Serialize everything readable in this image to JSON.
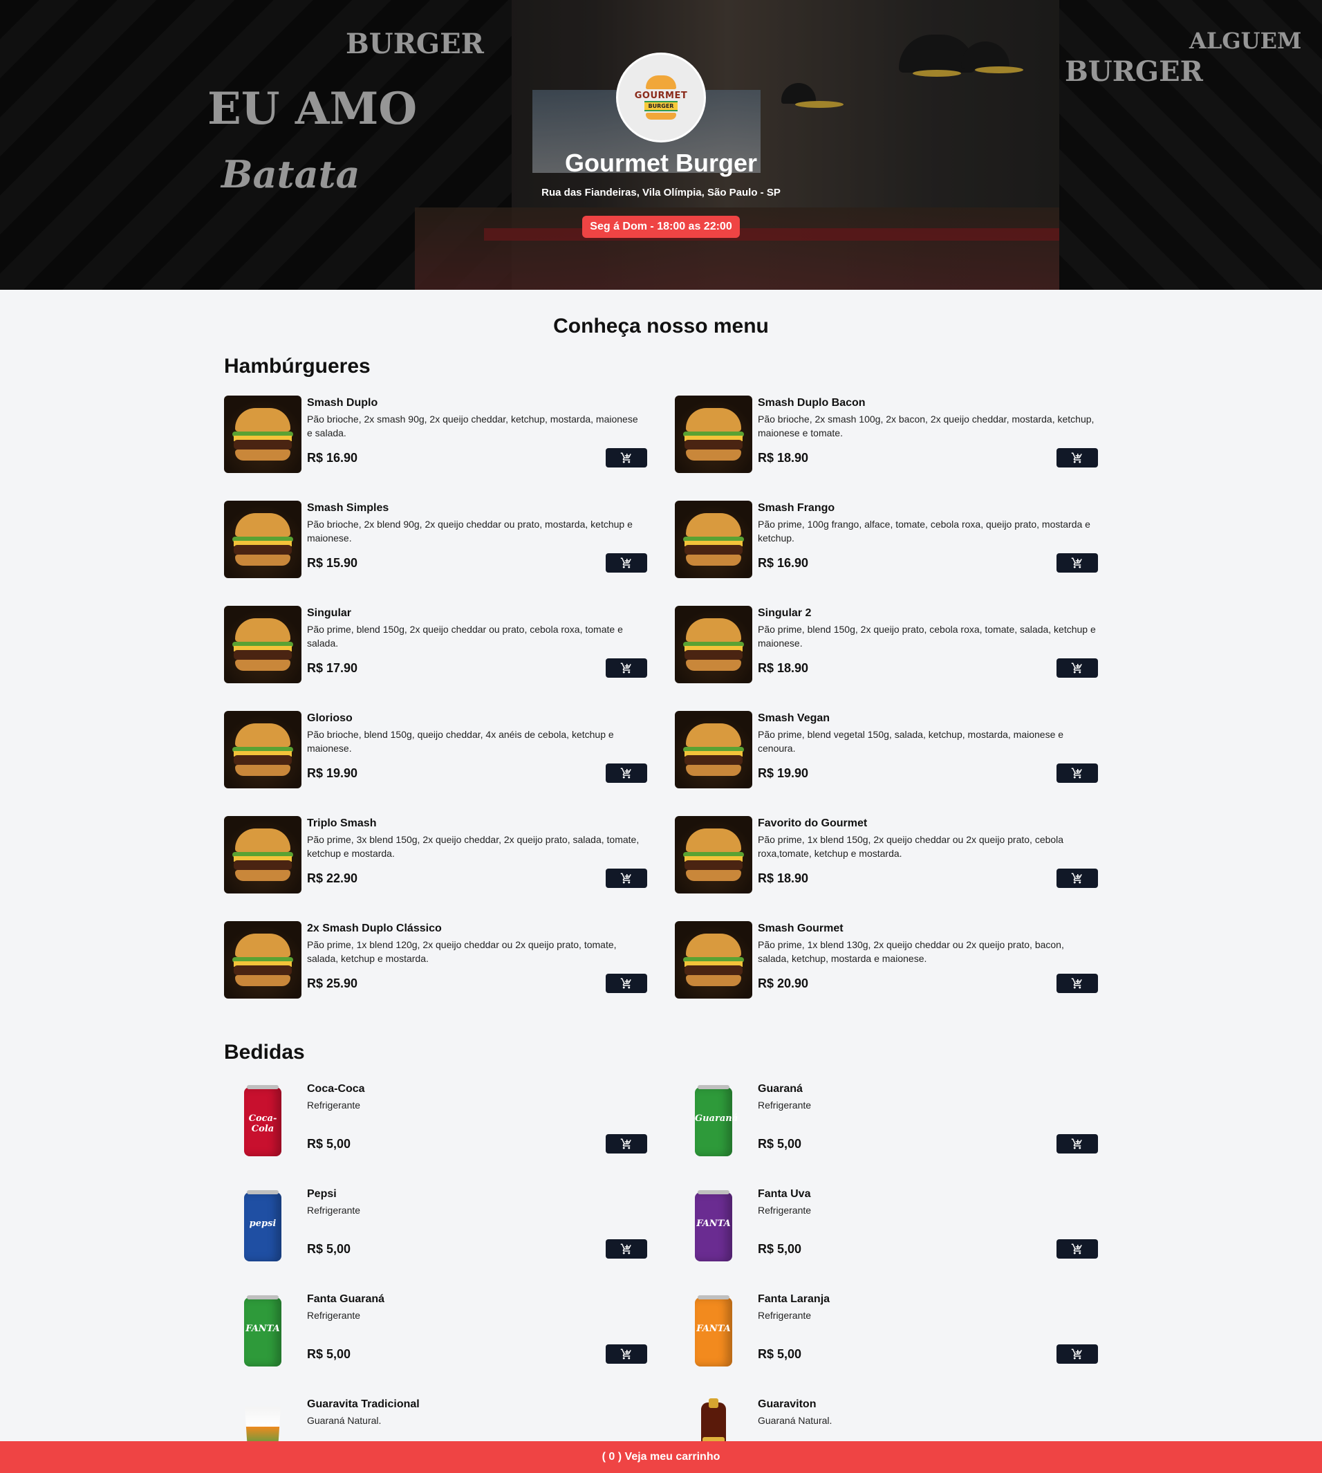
{
  "header": {
    "name": "Gourmet Burger",
    "address": "Rua das Fiandeiras, Vila Olímpia, São Paulo - SP",
    "hours": "Seg á Dom - 18:00 as 22:00",
    "logo_text": "GOURMET",
    "logo_sub": "BURGER",
    "logo_icon": "burger-logo"
  },
  "menu": {
    "title": "Conheça nosso menu",
    "sections": [
      {
        "title": "Hambúrgueres",
        "items": [
          {
            "name": "Smash Duplo",
            "desc": "Pão brioche, 2x smash 90g, 2x queijo cheddar, ketchup, mostarda, maionese e salada.",
            "price": "R$ 16.90"
          },
          {
            "name": "Smash Duplo Bacon",
            "desc": "Pão brioche, 2x smash 100g, 2x bacon, 2x queijo cheddar, mostarda, ketchup, maionese e tomate.",
            "price": "R$ 18.90"
          },
          {
            "name": "Smash Simples",
            "desc": "Pão brioche, 2x blend 90g, 2x queijo cheddar ou prato, mostarda, ketchup e maionese.",
            "price": "R$ 15.90"
          },
          {
            "name": "Smash Frango",
            "desc": "Pão prime, 100g frango, alface, tomate, cebola roxa, queijo prato, mostarda e ketchup.",
            "price": "R$ 16.90"
          },
          {
            "name": "Singular",
            "desc": "Pão prime, blend 150g, 2x queijo cheddar ou prato, cebola roxa, tomate e salada.",
            "price": "R$ 17.90"
          },
          {
            "name": "Singular 2",
            "desc": "Pão prime, blend 150g, 2x queijo prato, cebola roxa, tomate, salada, ketchup e maionese.",
            "price": "R$ 18.90"
          },
          {
            "name": "Glorioso",
            "desc": "Pão brioche, blend 150g, queijo cheddar, 4x anéis de cebola, ketchup e maionese.",
            "price": "R$ 19.90"
          },
          {
            "name": "Smash Vegan",
            "desc": "Pão prime, blend vegetal 150g, salada, ketchup, mostarda, maionese e cenoura.",
            "price": "R$ 19.90"
          },
          {
            "name": "Triplo Smash",
            "desc": "Pão prime, 3x blend 150g, 2x queijo cheddar, 2x queijo prato, salada, tomate, ketchup e mostarda.",
            "price": "R$ 22.90"
          },
          {
            "name": "Favorito do Gourmet",
            "desc": "Pão prime, 1x blend 150g, 2x queijo cheddar ou 2x queijo prato, cebola roxa,tomate, ketchup e mostarda.",
            "price": "R$ 18.90"
          },
          {
            "name": "2x Smash Duplo Clássico",
            "desc": "Pão prime, 1x blend 120g, 2x queijo cheddar ou 2x queijo prato, tomate, salada, ketchup e mostarda.",
            "price": "R$ 25.90"
          },
          {
            "name": "Smash Gourmet",
            "desc": "Pão prime, 1x blend 130g, 2x queijo cheddar ou 2x queijo prato, bacon, salada, ketchup, mostarda e maionese.",
            "price": "R$ 20.90"
          }
        ]
      },
      {
        "title": "Bedidas",
        "items": [
          {
            "name": "Coca-Coca",
            "desc": "Refrigerante",
            "price": "R$ 5,00",
            "can_color": "#c8102e",
            "can_text": "Coca-Cola"
          },
          {
            "name": "Guaraná",
            "desc": "Refrigerante",
            "price": "R$ 5,00",
            "can_color": "#2e9a3a",
            "can_text": "Guaraná"
          },
          {
            "name": "Pepsi",
            "desc": "Refrigerante",
            "price": "R$ 5,00",
            "can_color": "#1f4fa3",
            "can_text": "pepsi"
          },
          {
            "name": "Fanta Uva",
            "desc": "Refrigerante",
            "price": "R$ 5,00",
            "can_color": "#6a2c91",
            "can_text": "FANTA"
          },
          {
            "name": "Fanta Guaraná",
            "desc": "Refrigerante",
            "price": "R$ 5,00",
            "can_color": "#2e9a3a",
            "can_text": "FANTA"
          },
          {
            "name": "Fanta Laranja",
            "desc": "Refrigerante",
            "price": "R$ 5,00",
            "can_color": "#f28a1e",
            "can_text": "FANTA"
          },
          {
            "name": "Guaravita Tradicional",
            "desc": "Guaraná Natural.",
            "price": ""
          },
          {
            "name": "Guaraviton",
            "desc": "Guaraná Natural.",
            "price": ""
          }
        ]
      }
    ]
  },
  "cart": {
    "count": "0",
    "label": "Veja meu carrinho"
  },
  "colors": {
    "accent": "#ef4444",
    "button": "#111827"
  }
}
